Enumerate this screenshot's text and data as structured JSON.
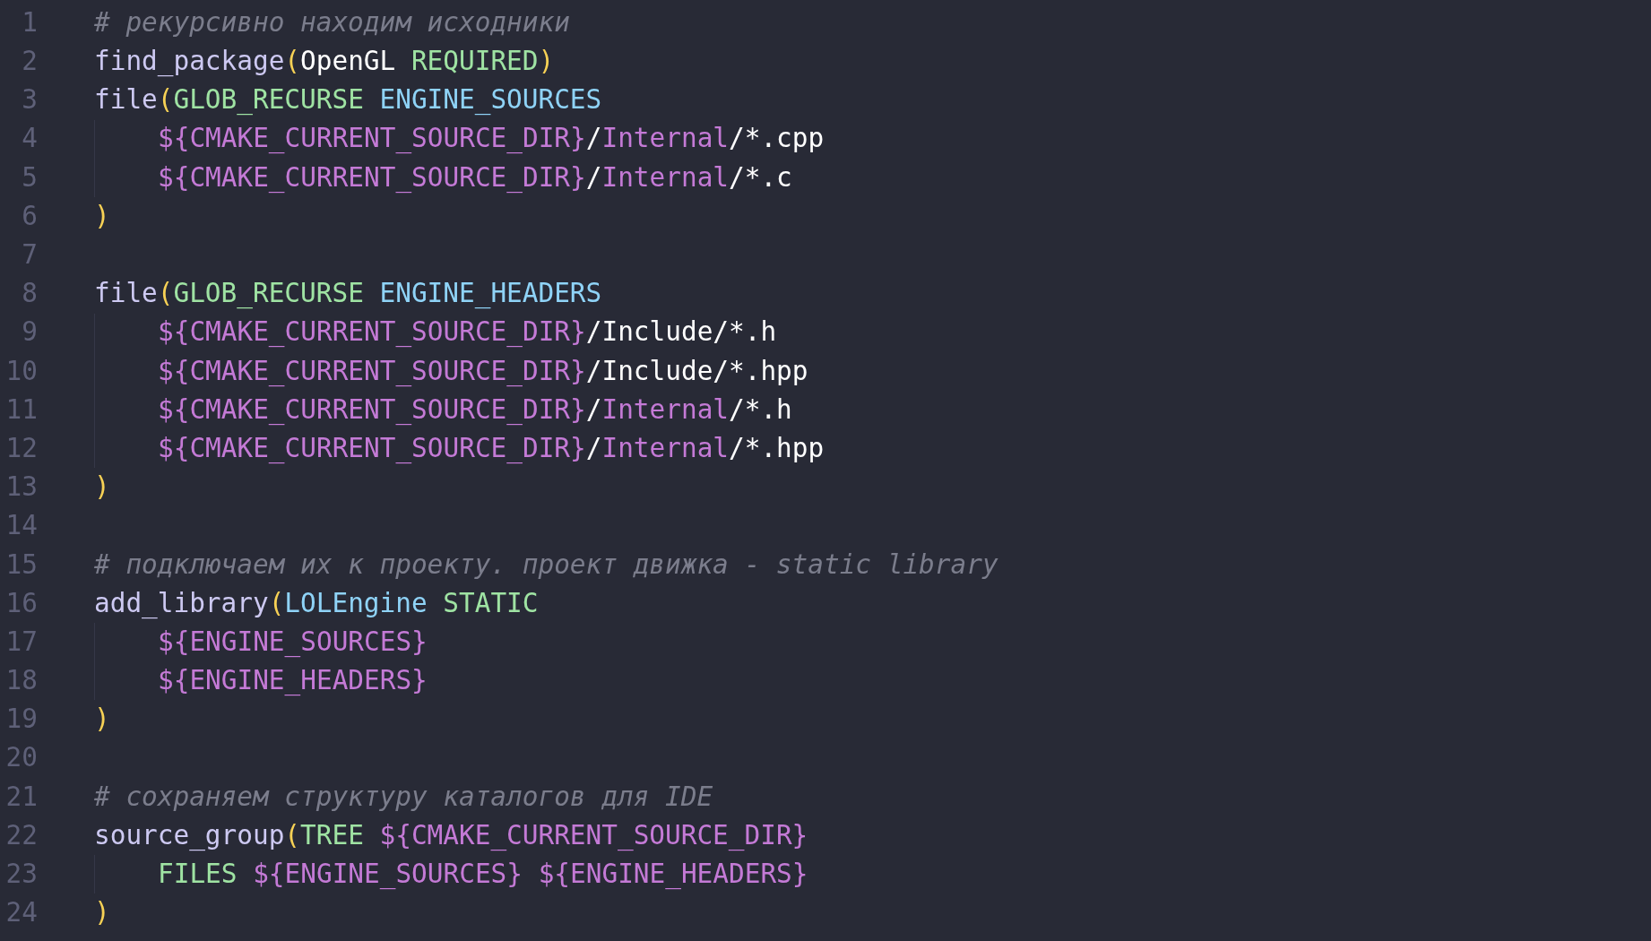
{
  "editor": {
    "lines": [
      {
        "number": "1",
        "indented": false,
        "tokens": [
          {
            "text": "# рекурсивно находим исходники",
            "kind": "comment"
          }
        ]
      },
      {
        "number": "2",
        "indented": false,
        "tokens": [
          {
            "text": "find_package",
            "kind": "function"
          },
          {
            "text": "(",
            "kind": "paren"
          },
          {
            "text": "OpenGL ",
            "kind": "plain"
          },
          {
            "text": "REQUIRED",
            "kind": "keyword"
          },
          {
            "text": ")",
            "kind": "paren"
          }
        ]
      },
      {
        "number": "3",
        "indented": false,
        "tokens": [
          {
            "text": "file",
            "kind": "function"
          },
          {
            "text": "(",
            "kind": "paren"
          },
          {
            "text": "GLOB_RECURSE ",
            "kind": "keyword"
          },
          {
            "text": "ENGINE_SOURCES",
            "kind": "variable"
          }
        ]
      },
      {
        "number": "4",
        "indented": true,
        "tokens": [
          {
            "text": "${CMAKE_CURRENT_SOURCE_DIR}",
            "kind": "reference"
          },
          {
            "text": "/",
            "kind": "plain"
          },
          {
            "text": "Internal",
            "kind": "reference"
          },
          {
            "text": "/*.cpp",
            "kind": "plain"
          }
        ]
      },
      {
        "number": "5",
        "indented": true,
        "tokens": [
          {
            "text": "${CMAKE_CURRENT_SOURCE_DIR}",
            "kind": "reference"
          },
          {
            "text": "/",
            "kind": "plain"
          },
          {
            "text": "Internal",
            "kind": "reference"
          },
          {
            "text": "/*.c",
            "kind": "plain"
          }
        ]
      },
      {
        "number": "6",
        "indented": false,
        "tokens": [
          {
            "text": ")",
            "kind": "paren"
          }
        ]
      },
      {
        "number": "7",
        "indented": false
      },
      {
        "number": "8",
        "indented": false,
        "tokens": [
          {
            "text": "file",
            "kind": "function"
          },
          {
            "text": "(",
            "kind": "paren"
          },
          {
            "text": "GLOB_RECURSE ",
            "kind": "keyword"
          },
          {
            "text": "ENGINE_HEADERS",
            "kind": "variable"
          }
        ]
      },
      {
        "number": "9",
        "indented": true,
        "tokens": [
          {
            "text": "${CMAKE_CURRENT_SOURCE_DIR}",
            "kind": "reference"
          },
          {
            "text": "/Include/*.h",
            "kind": "plain"
          }
        ]
      },
      {
        "number": "10",
        "indented": true,
        "tokens": [
          {
            "text": "${CMAKE_CURRENT_SOURCE_DIR}",
            "kind": "reference"
          },
          {
            "text": "/Include/*.hpp",
            "kind": "plain"
          }
        ]
      },
      {
        "number": "11",
        "indented": true,
        "tokens": [
          {
            "text": "${CMAKE_CURRENT_SOURCE_DIR}",
            "kind": "reference"
          },
          {
            "text": "/",
            "kind": "plain"
          },
          {
            "text": "Internal",
            "kind": "reference"
          },
          {
            "text": "/*.h",
            "kind": "plain"
          }
        ]
      },
      {
        "number": "12",
        "indented": true,
        "tokens": [
          {
            "text": "${CMAKE_CURRENT_SOURCE_DIR}",
            "kind": "reference"
          },
          {
            "text": "/",
            "kind": "plain"
          },
          {
            "text": "Internal",
            "kind": "reference"
          },
          {
            "text": "/*.hpp",
            "kind": "plain"
          }
        ]
      },
      {
        "number": "13",
        "indented": false,
        "tokens": [
          {
            "text": ")",
            "kind": "paren"
          }
        ]
      },
      {
        "number": "14",
        "indented": false
      },
      {
        "number": "15",
        "indented": false,
        "tokens": [
          {
            "text": "# подключаем их к проекту. проект движка - static library",
            "kind": "comment"
          }
        ]
      },
      {
        "number": "16",
        "indented": false,
        "tokens": [
          {
            "text": "add_library",
            "kind": "function"
          },
          {
            "text": "(",
            "kind": "paren"
          },
          {
            "text": "LOLEngine ",
            "kind": "variable"
          },
          {
            "text": "STATIC",
            "kind": "keyword"
          }
        ]
      },
      {
        "number": "17",
        "indented": true,
        "tokens": [
          {
            "text": "${ENGINE_SOURCES}",
            "kind": "reference"
          }
        ]
      },
      {
        "number": "18",
        "indented": true,
        "tokens": [
          {
            "text": "${ENGINE_HEADERS}",
            "kind": "reference"
          }
        ]
      },
      {
        "number": "19",
        "indented": false,
        "tokens": [
          {
            "text": ")",
            "kind": "paren"
          }
        ]
      },
      {
        "number": "20",
        "indented": false
      },
      {
        "number": "21",
        "indented": false,
        "tokens": [
          {
            "text": "# сохраняем структуру каталогов для IDE",
            "kind": "comment"
          }
        ]
      },
      {
        "number": "22",
        "indented": false,
        "tokens": [
          {
            "text": "source_group",
            "kind": "function"
          },
          {
            "text": "(",
            "kind": "paren"
          },
          {
            "text": "TREE ",
            "kind": "keyword"
          },
          {
            "text": "${CMAKE_CURRENT_SOURCE_DIR}",
            "kind": "reference"
          }
        ]
      },
      {
        "number": "23",
        "indented": true,
        "tokens": [
          {
            "text": "FILES ",
            "kind": "keyword"
          },
          {
            "text": "${ENGINE_SOURCES} ${ENGINE_HEADERS}",
            "kind": "reference"
          }
        ]
      },
      {
        "number": "24",
        "indented": false,
        "tokens": [
          {
            "text": ")",
            "kind": "paren"
          }
        ]
      }
    ]
  }
}
